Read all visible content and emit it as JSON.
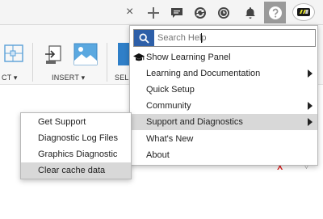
{
  "topbar": {
    "tab_close_glyph": "×",
    "icons": [
      "plus-icon",
      "chat-icon",
      "sync-icon",
      "clock-icon",
      "bell-icon",
      "help-icon",
      "user-avatar"
    ]
  },
  "ribbon": {
    "groups": [
      {
        "label": "CT ▾",
        "icon": "select-box-icon"
      },
      {
        "label": "INSERT ▾",
        "icon": "insert-icon"
      },
      {
        "label": "SEL",
        "icon": "select-icon"
      }
    ]
  },
  "help_menu": {
    "search_placeholder": "Search Help",
    "items": [
      {
        "label": "Show Learning Panel",
        "has_submenu": false,
        "icon": "graduation-cap-icon"
      },
      {
        "label": "Learning and Documentation",
        "has_submenu": true
      },
      {
        "label": "Quick Setup",
        "has_submenu": false
      },
      {
        "label": "Community",
        "has_submenu": true
      },
      {
        "label": "Support and Diagnostics",
        "has_submenu": true,
        "active": true
      },
      {
        "label": "What's New",
        "has_submenu": false
      },
      {
        "label": "About",
        "has_submenu": false
      }
    ]
  },
  "support_submenu": {
    "items": [
      {
        "label": "Get Support"
      },
      {
        "label": "Diagnostic Log Files"
      },
      {
        "label": "Graphics Diagnostic"
      },
      {
        "label": "Clear cache data",
        "active": true
      }
    ]
  },
  "canvas": {
    "red_x": "X",
    "chevron": "▽"
  },
  "colors": {
    "search_button": "#2d5fa8",
    "active_item": "#d8d8d8",
    "help_button_active": "#9a9a9a"
  }
}
